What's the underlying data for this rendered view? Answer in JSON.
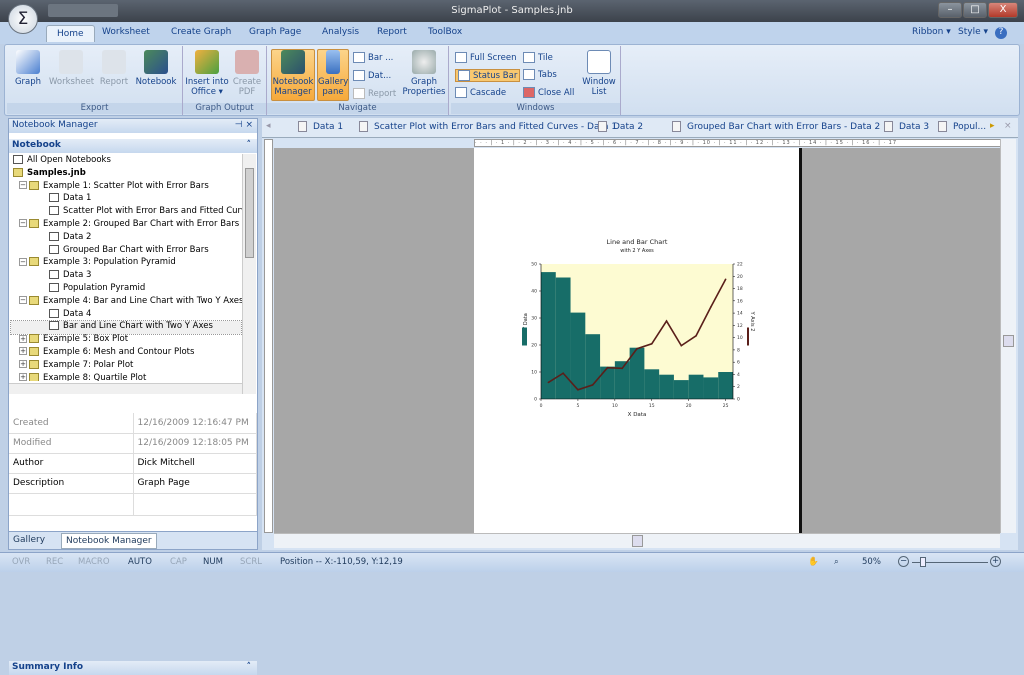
{
  "window": {
    "title": "SigmaPlot - Samples.jnb",
    "app_symbol": "Σ",
    "minimize": "–",
    "maximize": "□",
    "close": "X"
  },
  "ribbon": {
    "tabs": [
      "Home",
      "Worksheet",
      "Create Graph",
      "Graph Page",
      "Analysis",
      "Report",
      "ToolBox"
    ],
    "active_tab": "Home",
    "right": {
      "ribbon": "Ribbon ▾",
      "style": "Style ▾",
      "help": "?"
    },
    "groups": {
      "export": {
        "label": "Export",
        "buttons": [
          "Graph",
          "Worksheet",
          "Report",
          "Notebook"
        ]
      },
      "graph_output": {
        "label": "Graph Output",
        "buttons": [
          "Insert into Office ▾",
          "Create PDF"
        ]
      },
      "navigate": {
        "label": "Navigate",
        "buttons": [
          "Notebook Manager",
          "Gallery pane"
        ],
        "small": [
          "Bar ...",
          "Dat...",
          "Report"
        ],
        "graph_properties": "Graph Properties"
      },
      "windows": {
        "label": "Windows",
        "small": [
          "Full Screen",
          "Status Bar",
          "Cascade",
          "Tile",
          "Tabs",
          "Close All"
        ],
        "window_list": "Window List"
      }
    }
  },
  "notebook_manager": {
    "title": "Notebook Manager",
    "section": "Notebook",
    "tree": [
      {
        "label": "All Open Notebooks",
        "level": 0,
        "icon": "notebooks-icon"
      },
      {
        "label": "Samples.jnb",
        "level": 0,
        "icon": "notebook-icon",
        "bold": true
      },
      {
        "label": "Example 1: Scatter Plot with Error Bars",
        "level": 1,
        "icon": "section-icon"
      },
      {
        "label": "Data 1",
        "level": 2,
        "icon": "worksheet-icon"
      },
      {
        "label": "Scatter Plot with Error Bars and Fitted Curves",
        "level": 2,
        "icon": "graph-icon"
      },
      {
        "label": "Example 2: Grouped Bar Chart with Error Bars",
        "level": 1,
        "icon": "section-icon"
      },
      {
        "label": "Data 2",
        "level": 2,
        "icon": "worksheet-icon"
      },
      {
        "label": "Grouped Bar Chart with Error Bars",
        "level": 2,
        "icon": "graph-icon"
      },
      {
        "label": "Example 3: Population Pyramid",
        "level": 1,
        "icon": "section-icon"
      },
      {
        "label": "Data 3",
        "level": 2,
        "icon": "worksheet-icon"
      },
      {
        "label": "Population Pyramid",
        "level": 2,
        "icon": "graph-icon"
      },
      {
        "label": "Example 4: Bar and Line Chart with Two Y Axes",
        "level": 1,
        "icon": "section-icon"
      },
      {
        "label": "Data 4",
        "level": 2,
        "icon": "worksheet-icon"
      },
      {
        "label": "Bar and Line Chart with Two Y Axes",
        "level": 2,
        "icon": "graph-icon",
        "selected": true
      },
      {
        "label": "Example 5: Box Plot",
        "level": 1,
        "icon": "section-icon"
      },
      {
        "label": "Example 6: Mesh and Contour Plots",
        "level": 1,
        "icon": "section-icon"
      },
      {
        "label": "Example 7: Polar Plot",
        "level": 1,
        "icon": "section-icon"
      },
      {
        "label": "Example 8: Quartile Plot",
        "level": 1,
        "icon": "section-icon"
      }
    ],
    "summary_title": "Summary Info",
    "summary": [
      {
        "key": "Created",
        "value": "12/16/2009 12:16:47 PM",
        "readonly": true
      },
      {
        "key": "Modified",
        "value": "12/16/2009 12:18:05 PM",
        "readonly": true
      },
      {
        "key": "Author",
        "value": "Dick Mitchell"
      },
      {
        "key": "Description",
        "value": "Graph Page"
      }
    ],
    "bottom_tabs": [
      "Gallery",
      "Notebook Manager"
    ]
  },
  "doc_tabs": [
    "Data 1",
    "Scatter Plot with Error Bars and Fitted Curves - Data 1",
    "Data 2",
    "Grouped Bar Chart with Error Bars - Data 2",
    "Data 3",
    "Popul..."
  ],
  "ruler": "· · · | · 1 · | · 2 · | · 3 · | · 4 · | · 5 · | · 6 · | · 7 · | · 8 · | · 9 · | · 10 · | · 11 · | · 12 · | · 13 · | · 14 · | · 15 · | · 16 · | · 17",
  "status": {
    "indicators": [
      {
        "t": "OVR",
        "on": false
      },
      {
        "t": "REC",
        "on": false
      },
      {
        "t": "MACRO",
        "on": false
      },
      {
        "t": "AUTO",
        "on": true
      },
      {
        "t": "CAP",
        "on": false
      },
      {
        "t": "NUM",
        "on": true
      },
      {
        "t": "SCRL",
        "on": false
      }
    ],
    "position": "Position -- X:-110,59, Y:12,19",
    "zoom": "50%",
    "zoom_level": 0.15
  },
  "chart_data": {
    "type": "bar+line",
    "title": "Line and Bar Chart",
    "subtitle": "with 2 Y Axes",
    "xlabel": "X Data",
    "ylabel": "Y Data",
    "y2label": "Y Axis 2",
    "xlim": [
      0,
      26
    ],
    "ylim": [
      0,
      50
    ],
    "y2lim": [
      0,
      22
    ],
    "xticks": [
      0,
      5,
      10,
      15,
      20,
      25
    ],
    "yticks": [
      0,
      10,
      20,
      30,
      40,
      50
    ],
    "y2ticks": [
      0,
      2,
      4,
      6,
      8,
      10,
      12,
      14,
      16,
      18,
      20,
      22
    ],
    "x": [
      1,
      3,
      5,
      7,
      9,
      11,
      13,
      15,
      17,
      19,
      21,
      23,
      25
    ],
    "bar_values": [
      47,
      45,
      32,
      24,
      12,
      14,
      19,
      11,
      9,
      7,
      9,
      8,
      10
    ],
    "line_values": [
      2.7,
      4.2,
      1.5,
      2.3,
      5.1,
      5.0,
      8.2,
      9.0,
      12.7,
      8.7,
      10.3,
      15.0,
      19.5
    ],
    "bar_color": "#176d68",
    "line_color": "#5a1f1a",
    "plot_background": "#fdfbd2"
  }
}
